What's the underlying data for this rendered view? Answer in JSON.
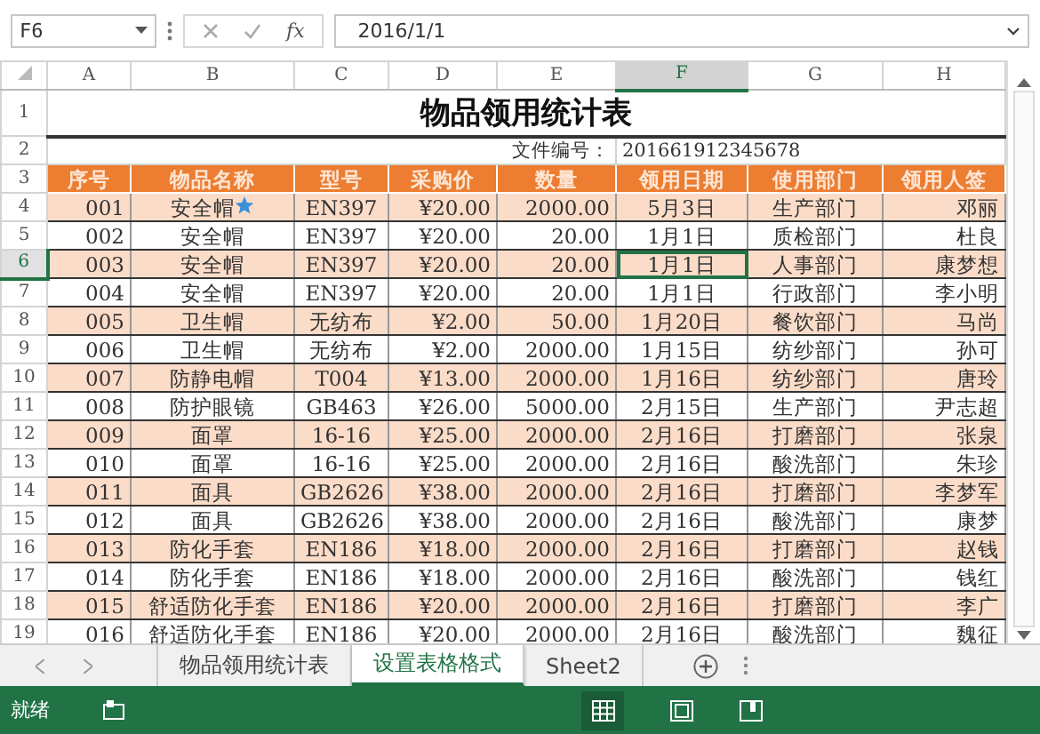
{
  "formula_bar": {
    "name_box": "F6",
    "function_label": "fx",
    "value": "2016/1/1"
  },
  "columns": [
    {
      "label": "A",
      "selected": false
    },
    {
      "label": "B",
      "selected": false
    },
    {
      "label": "C",
      "selected": false
    },
    {
      "label": "D",
      "selected": false
    },
    {
      "label": "E",
      "selected": false
    },
    {
      "label": "F",
      "selected": true
    },
    {
      "label": "G",
      "selected": false
    },
    {
      "label": "H",
      "selected": false
    }
  ],
  "rows": [
    {
      "number": "1",
      "kind": "title",
      "selected": false,
      "cells": [
        "物品领用统计表"
      ]
    },
    {
      "number": "2",
      "kind": "info",
      "selected": false,
      "cells": [
        "文件编号：",
        "201661912345678"
      ]
    },
    {
      "number": "3",
      "kind": "header",
      "selected": false,
      "cells": [
        "序号",
        "物品名称",
        "型号",
        "采购价",
        "数量",
        "领用日期",
        "使用部门",
        "领用人签"
      ]
    },
    {
      "number": "4",
      "kind": "data",
      "selected": false,
      "shaded": true,
      "starred": true,
      "cells": [
        "001",
        "安全帽",
        "EN397",
        "¥20.00",
        "2000.00",
        "5月3日",
        "生产部门",
        "邓丽"
      ]
    },
    {
      "number": "5",
      "kind": "data",
      "selected": false,
      "shaded": false,
      "starred": false,
      "cells": [
        "002",
        "安全帽",
        "EN397",
        "¥20.00",
        "20.00",
        "1月1日",
        "质检部门",
        "杜良"
      ]
    },
    {
      "number": "6",
      "kind": "data",
      "selected": true,
      "shaded": true,
      "starred": false,
      "cells": [
        "003",
        "安全帽",
        "EN397",
        "¥20.00",
        "20.00",
        "1月1日",
        "人事部门",
        "康梦想"
      ]
    },
    {
      "number": "7",
      "kind": "data",
      "selected": false,
      "shaded": false,
      "starred": false,
      "cells": [
        "004",
        "安全帽",
        "EN397",
        "¥20.00",
        "20.00",
        "1月1日",
        "行政部门",
        "李小明"
      ]
    },
    {
      "number": "8",
      "kind": "data",
      "selected": false,
      "shaded": true,
      "starred": false,
      "cells": [
        "005",
        "卫生帽",
        "无纺布",
        "¥2.00",
        "50.00",
        "1月20日",
        "餐饮部门",
        "马尚"
      ]
    },
    {
      "number": "9",
      "kind": "data",
      "selected": false,
      "shaded": false,
      "starred": false,
      "cells": [
        "006",
        "卫生帽",
        "无纺布",
        "¥2.00",
        "2000.00",
        "1月15日",
        "纺纱部门",
        "孙可"
      ]
    },
    {
      "number": "10",
      "kind": "data",
      "selected": false,
      "shaded": true,
      "starred": false,
      "cells": [
        "007",
        "防静电帽",
        "T004",
        "¥13.00",
        "2000.00",
        "1月16日",
        "纺纱部门",
        "唐玲"
      ]
    },
    {
      "number": "11",
      "kind": "data",
      "selected": false,
      "shaded": false,
      "starred": false,
      "cells": [
        "008",
        "防护眼镜",
        "GB463",
        "¥26.00",
        "5000.00",
        "2月15日",
        "生产部门",
        "尹志超"
      ]
    },
    {
      "number": "12",
      "kind": "data",
      "selected": false,
      "shaded": true,
      "starred": false,
      "cells": [
        "009",
        "面罩",
        "16-16",
        "¥25.00",
        "2000.00",
        "2月16日",
        "打磨部门",
        "张泉"
      ]
    },
    {
      "number": "13",
      "kind": "data",
      "selected": false,
      "shaded": false,
      "starred": false,
      "cells": [
        "010",
        "面罩",
        "16-16",
        "¥25.00",
        "2000.00",
        "2月16日",
        "酸洗部门",
        "朱珍"
      ]
    },
    {
      "number": "14",
      "kind": "data",
      "selected": false,
      "shaded": true,
      "starred": false,
      "cells": [
        "011",
        "面具",
        "GB2626",
        "¥38.00",
        "2000.00",
        "2月16日",
        "打磨部门",
        "李梦军"
      ]
    },
    {
      "number": "15",
      "kind": "data",
      "selected": false,
      "shaded": false,
      "starred": false,
      "cells": [
        "012",
        "面具",
        "GB2626",
        "¥38.00",
        "2000.00",
        "2月16日",
        "酸洗部门",
        "康梦"
      ]
    },
    {
      "number": "16",
      "kind": "data",
      "selected": false,
      "shaded": true,
      "starred": false,
      "cells": [
        "013",
        "防化手套",
        "EN186",
        "¥18.00",
        "2000.00",
        "2月16日",
        "打磨部门",
        "赵钱"
      ]
    },
    {
      "number": "17",
      "kind": "data",
      "selected": false,
      "shaded": false,
      "starred": false,
      "cells": [
        "014",
        "防化手套",
        "EN186",
        "¥18.00",
        "2000.00",
        "2月16日",
        "酸洗部门",
        "钱红"
      ]
    },
    {
      "number": "18",
      "kind": "data",
      "selected": false,
      "shaded": true,
      "starred": false,
      "cells": [
        "015",
        "舒适防化手套",
        "EN186",
        "¥20.00",
        "2000.00",
        "2月16日",
        "打磨部门",
        "李广"
      ]
    },
    {
      "number": "19",
      "kind": "data",
      "selected": false,
      "shaded": false,
      "starred": false,
      "cells": [
        "016",
        "舒适防化手套",
        "EN186",
        "¥20.00",
        "2000.00",
        "2月16日",
        "酸洗部门",
        "魏征"
      ]
    }
  ],
  "sheet_tabs": [
    {
      "label": "物品领用统计表",
      "selected": false
    },
    {
      "label": "设置表格格式",
      "selected": true
    },
    {
      "label": "Sheet2",
      "selected": false
    }
  ],
  "status_bar": {
    "status": "就绪"
  }
}
